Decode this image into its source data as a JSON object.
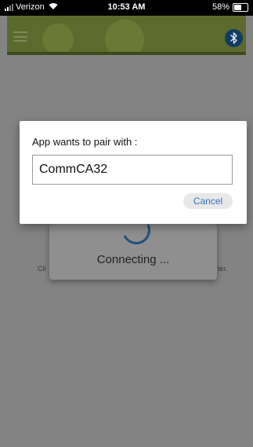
{
  "status_bar": {
    "carrier": "Verizon",
    "time": "10:53 AM",
    "battery_percent": "58%",
    "battery_level": 0.58
  },
  "header": {
    "menu_icon": "hamburger-menu-icon",
    "bluetooth_icon": "bluetooth-icon",
    "colors": {
      "bar": "#5c6b2d",
      "bluetooth": "#0f3d62"
    }
  },
  "background_text": {
    "left_fragment": "Cli",
    "right_fragment": "ter."
  },
  "connecting": {
    "text": "Connecting ..."
  },
  "pair_dialog": {
    "title": "App wants to pair with :",
    "device_name": "CommCA32",
    "cancel_label": "Cancel"
  }
}
